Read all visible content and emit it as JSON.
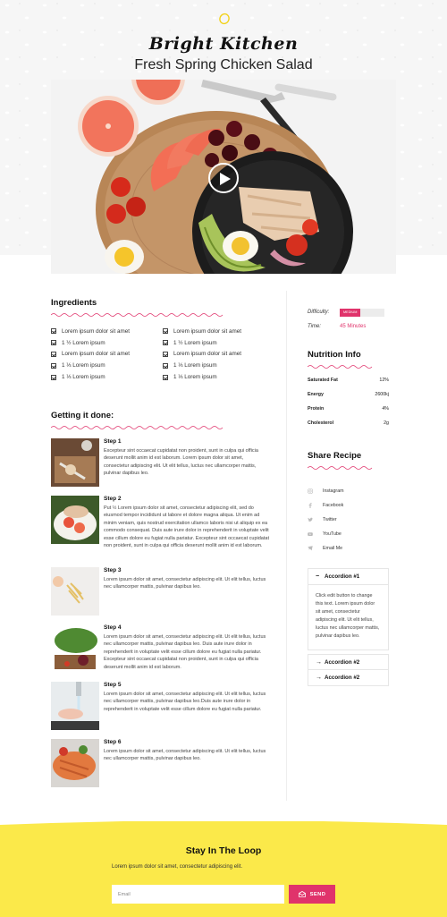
{
  "header": {
    "brand": "Bright Kitchen",
    "title": "Fresh Spring Chicken Salad"
  },
  "ingredients": {
    "heading": "Ingredients",
    "left": [
      "Lorem ipsum dolor sit amet",
      "1 ½ Lorem ipsum",
      "Lorem ipsum dolor sit amet",
      "1 ⅓ Lorem ipsum",
      "1 ⅓ Lorem ipsum"
    ],
    "right": [
      "Lorem ipsum dolor sit amet",
      "1 ½ Lorem ipsum",
      "Lorem ipsum dolor sit amet",
      "1 ⅓ Lorem ipsum",
      "1 ⅓ Lorem ipsum"
    ]
  },
  "steps": {
    "heading": "Getting it done:",
    "items": [
      {
        "title": "Step 1",
        "text": "Excepteur sint occaecat cupidatat non proident, sunt in culpa qui officia deserunt mollit anim id est laborum. Lorem ipsum dolor sit amet, consectetur adipiscing elit. Ut elit tellus, luctus nec ullamcorper mattis, pulvinar dapibus leo."
      },
      {
        "title": "Step 2",
        "text": "Put ½ Lorem ipsum dolor sit amet, consectetur adipiscing elit, sed do eiusmod tempor incididunt ut labore et dolore magna aliqua. Ut enim ad minim veniam, quis nostrud exercitation ullamco laboris nisi ut aliquip ex ea commodo consequat. Duis aute irure dolor in reprehenderit in voluptate velit esse cillum dolore eu fugiat nulla pariatur. Excepteur sint occaecat cupidatat non proident, sunt in culpa qui officia deserunt mollit anim id est laborum."
      },
      {
        "title": "Step 3",
        "text": "Lorem ipsum dolor sit amet, consectetur adipiscing elit. Ut elit tellus, luctus nec ullamcorper mattis, pulvinar dapibus leo."
      },
      {
        "title": "Step 4",
        "text": "Lorem ipsum dolor sit amet, consectetur adipiscing elit. Ut elit tellus, luctus nec ullamcorper mattis, pulvinar dapibus leo. Duis aute irure dolor in reprehenderit in voluptate velit esse cillum dolore eu fugiat nulla pariatur. Excepteur sint occaecat cupidatat non proident, sunt in culpa qui officia deserunt mollit anim id est laborum."
      },
      {
        "title": "Step 5",
        "text": "Lorem ipsum dolor sit amet, consectetur adipiscing elit. Ut elit tellus, luctus nec ullamcorper mattis, pulvinar dapibus leo.Duis aute irure dolor in reprehenderit in voluptate velit esse cillum dolore eu fugiat nulla pariatur."
      },
      {
        "title": "Step 6",
        "text": "Lorem ipsum dolor sit amet, consectetur adipiscing elit. Ut elit tellus, luctus nec ullamcorper mattis, pulvinar dapibus leo."
      }
    ]
  },
  "meta": {
    "difficulty_label": "Difficulty:",
    "difficulty_value": "MEDIUM",
    "difficulty_fraction": 0.45,
    "time_label": "Time:",
    "time_value": "45 Minutes"
  },
  "nutrition": {
    "heading": "Nutrition Info",
    "rows": [
      {
        "name": "Saturated Fat",
        "value": "12%"
      },
      {
        "name": "Energy",
        "value": "2600kj"
      },
      {
        "name": "Protein",
        "value": "4%"
      },
      {
        "name": "Cholesterol",
        "value": "2g"
      }
    ]
  },
  "share": {
    "heading": "Share Recipe",
    "items": [
      {
        "label": "Instagram",
        "icon": "instagram-icon"
      },
      {
        "label": "Facebook",
        "icon": "facebook-icon"
      },
      {
        "label": "Twitter",
        "icon": "twitter-icon"
      },
      {
        "label": "YouTube",
        "icon": "youtube-icon"
      },
      {
        "label": "Email Me",
        "icon": "email-icon"
      }
    ]
  },
  "accordion": {
    "items": [
      {
        "title": "Accordion #1",
        "open": true,
        "text": "Click edit button to change this text. Lorem ipsum dolor sit amet, consectetur adipiscing elit. Ut elit tellus, luctus nec ullamcorper mattis, pulvinar dapibus leo."
      },
      {
        "title": "Accordion #2",
        "open": false
      },
      {
        "title": "Accordion #2",
        "open": false
      }
    ]
  },
  "newsletter": {
    "title": "Stay In The Loop",
    "subtitle": "Lorem ipsum dolor sit amet, consectetur adipiscing elit.",
    "email_placeholder": "Email",
    "send_label": "SEND"
  },
  "colors": {
    "accent": "#e0336b",
    "footer_yellow": "#fbe94a"
  }
}
